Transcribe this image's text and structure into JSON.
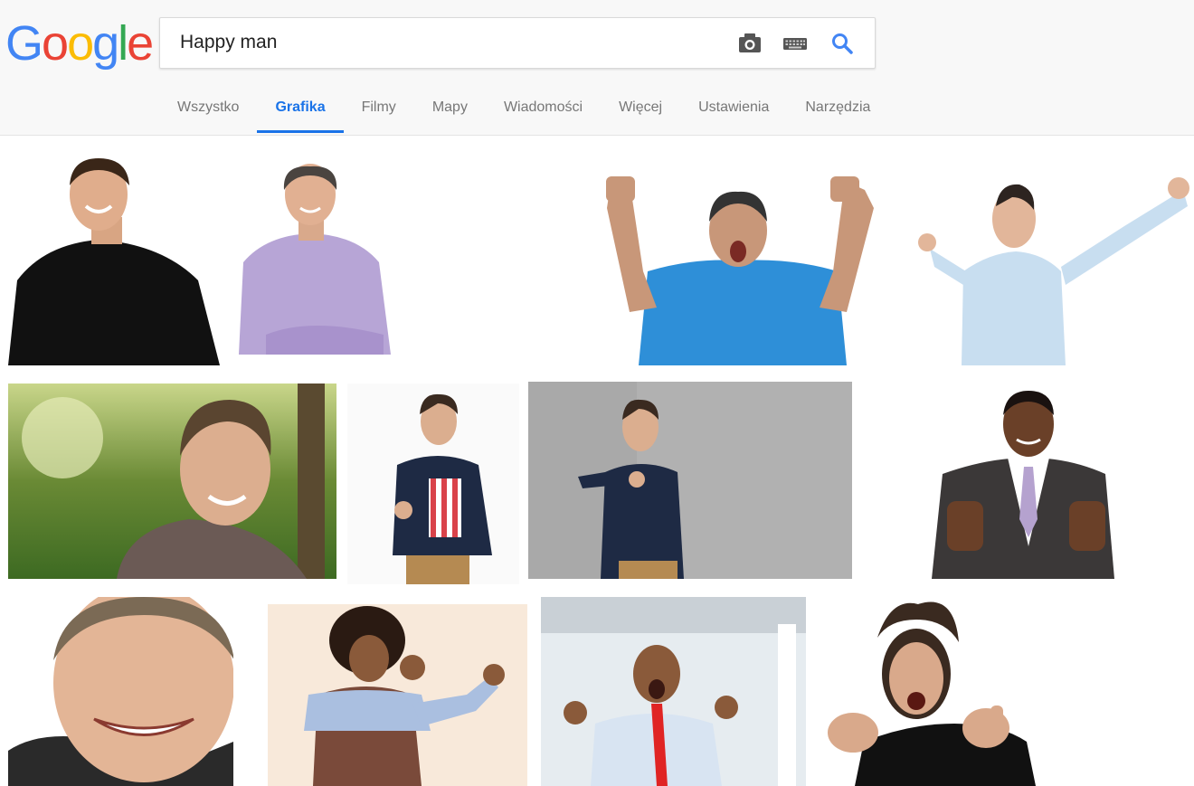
{
  "logo": {
    "letters": [
      "G",
      "o",
      "o",
      "g",
      "l",
      "e"
    ],
    "colors": [
      "#4285F4",
      "#EA4335",
      "#FBBC05",
      "#4285F4",
      "#34A853",
      "#EA4335"
    ]
  },
  "search": {
    "query": "Happy man"
  },
  "tabs": [
    "Wszystko",
    "Grafika",
    "Filmy",
    "Mapy",
    "Wiadomości",
    "Więcej",
    "Ustawienia",
    "Narzędzia"
  ],
  "active_tab": "Grafika",
  "colors": {
    "accent": "#1a73e8"
  },
  "results": [
    {
      "desc": "smiling man in black t-shirt"
    },
    {
      "desc": "smiling man in lavender shirt with crossed arms"
    },
    {
      "desc": "man in blue t-shirt cheering with fists up"
    },
    {
      "desc": "man in light blue shirt with arms raised"
    },
    {
      "desc": "smiling man in park"
    },
    {
      "desc": "man holding popcorn"
    },
    {
      "desc": "man pointing against concrete wall"
    },
    {
      "desc": "man in suit giving thumbs up"
    },
    {
      "desc": "laughing man close-up"
    },
    {
      "desc": "man with afro dancing"
    },
    {
      "desc": "man with red tie cheering"
    },
    {
      "desc": "man with wild hair giving thumbs up"
    }
  ]
}
